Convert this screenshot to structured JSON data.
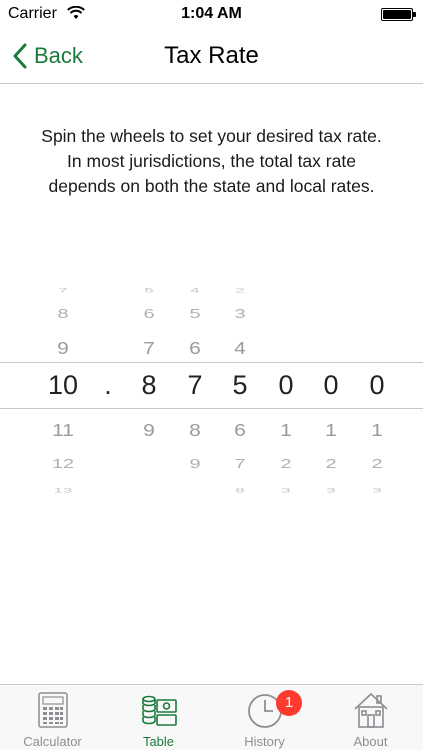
{
  "status_bar": {
    "carrier": "Carrier",
    "time": "1:04 AM"
  },
  "nav": {
    "back_label": "Back",
    "title": "Tax Rate"
  },
  "instructions": "Spin the wheels to set your desired tax rate.  In most jurisdictions, the total tax rate depends on both the state and local rates.",
  "picker": {
    "separator": ".",
    "selected_value": "10.875000",
    "wheels": [
      {
        "name": "whole",
        "above": [
          "7",
          "8",
          "9"
        ],
        "selected": "10",
        "below": [
          "11",
          "12",
          "13"
        ]
      },
      {
        "name": "tenths",
        "above": [
          "5",
          "6",
          "7"
        ],
        "selected": "8",
        "below": [
          "9",
          "",
          ""
        ]
      },
      {
        "name": "hundredths",
        "above": [
          "4",
          "5",
          "6"
        ],
        "selected": "7",
        "below": [
          "8",
          "9",
          ""
        ]
      },
      {
        "name": "thousandths",
        "above": [
          "2",
          "3",
          "4"
        ],
        "selected": "5",
        "below": [
          "6",
          "7",
          "8"
        ]
      },
      {
        "name": "ten-thousandths",
        "above": [
          "",
          "",
          ""
        ],
        "selected": "0",
        "below": [
          "1",
          "2",
          "3"
        ]
      },
      {
        "name": "hundred-thousandths",
        "above": [
          "",
          "",
          ""
        ],
        "selected": "0",
        "below": [
          "1",
          "2",
          "3"
        ]
      },
      {
        "name": "millionths",
        "above": [
          "",
          "",
          ""
        ],
        "selected": "0",
        "below": [
          "1",
          "2",
          "3"
        ]
      }
    ]
  },
  "tabs": [
    {
      "label": "Calculator",
      "icon": "calculator-icon",
      "active": false
    },
    {
      "label": "Table",
      "icon": "table-money-icon",
      "active": true
    },
    {
      "label": "History",
      "icon": "clock-icon",
      "active": false
    },
    {
      "label": "About",
      "icon": "house-icon",
      "active": false
    }
  ],
  "history_badge": "1",
  "colors": {
    "accent": "#1a7a3c",
    "badge": "#ff3b30",
    "inactive": "#8e8e93"
  }
}
